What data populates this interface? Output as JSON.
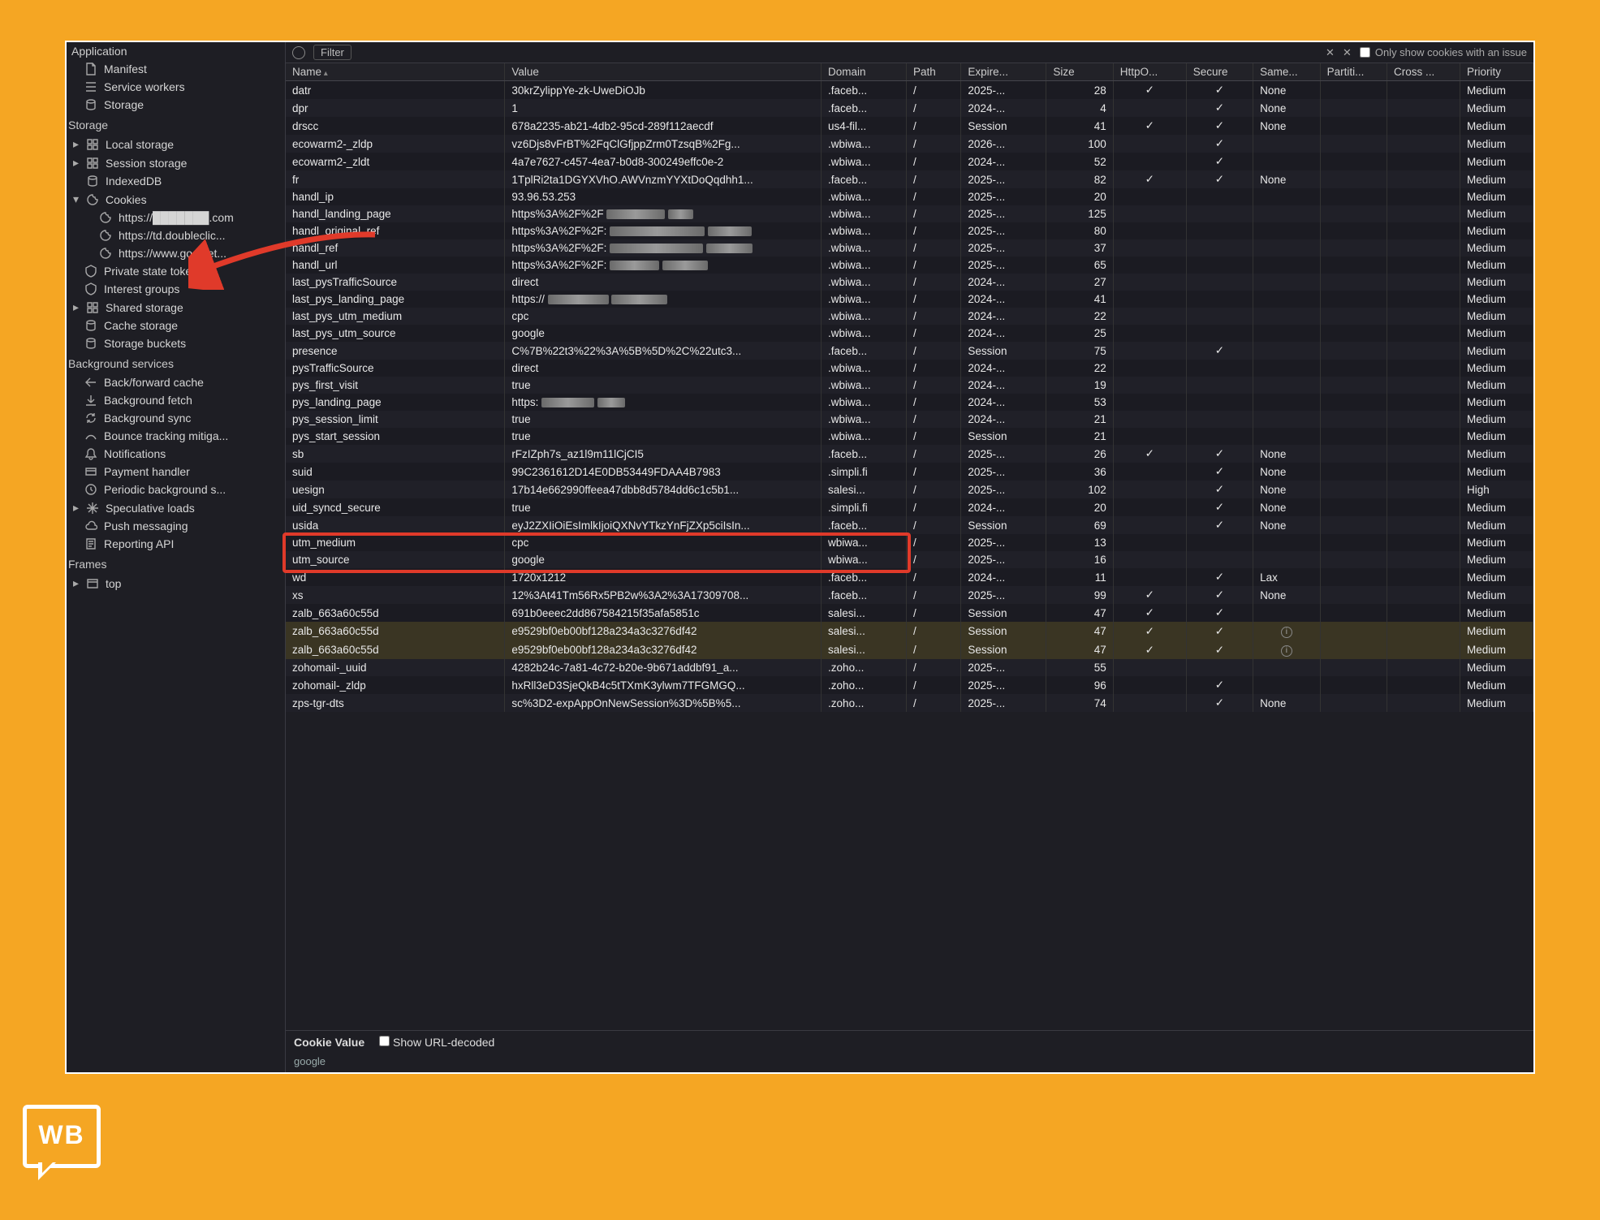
{
  "sidebar": {
    "header": "Application",
    "top_items": [
      {
        "icon": "file",
        "label": "Manifest"
      },
      {
        "icon": "gear-stack",
        "label": "Service workers"
      },
      {
        "icon": "db",
        "label": "Storage"
      }
    ],
    "storage_title": "Storage",
    "storage_items": [
      {
        "tri": "▸",
        "icon": "grid",
        "label": "Local storage"
      },
      {
        "tri": "▸",
        "icon": "grid",
        "label": "Session storage"
      },
      {
        "tri": "",
        "icon": "db",
        "label": "IndexedDB"
      },
      {
        "tri": "▾",
        "icon": "cookie",
        "label": "Cookies"
      }
    ],
    "cookie_children": [
      {
        "icon": "cookie",
        "label": "https://███████.com"
      },
      {
        "icon": "cookie",
        "label": "https://td.doubleclic..."
      },
      {
        "icon": "cookie",
        "label": "https://www.googlet..."
      }
    ],
    "storage_items2": [
      {
        "icon": "token",
        "label": "Private state tokens"
      },
      {
        "icon": "token",
        "label": "Interest groups"
      },
      {
        "tri": "▸",
        "icon": "grid",
        "label": "Shared storage"
      },
      {
        "icon": "db",
        "label": "Cache storage"
      },
      {
        "icon": "db",
        "label": "Storage buckets"
      }
    ],
    "bg_title": "Background services",
    "bg_items": [
      {
        "icon": "back",
        "label": "Back/forward cache"
      },
      {
        "icon": "down",
        "label": "Background fetch"
      },
      {
        "icon": "sync",
        "label": "Background sync"
      },
      {
        "icon": "bounce",
        "label": "Bounce tracking mitiga..."
      },
      {
        "icon": "bell",
        "label": "Notifications"
      },
      {
        "icon": "card",
        "label": "Payment handler"
      },
      {
        "icon": "clock",
        "label": "Periodic background s..."
      },
      {
        "tri": "▸",
        "icon": "spark",
        "label": "Speculative loads"
      },
      {
        "icon": "cloud",
        "label": "Push messaging"
      },
      {
        "icon": "report",
        "label": "Reporting API"
      }
    ],
    "frames_title": "Frames",
    "frames_items": [
      {
        "tri": "▸",
        "icon": "window",
        "label": "top"
      }
    ]
  },
  "toolbar": {
    "filter_label": "Filter",
    "only_issue_label": "Only show cookies with an issue"
  },
  "columns": [
    "Name",
    "Value",
    "Domain",
    "Path",
    "Expire...",
    "Size",
    "HttpO...",
    "Secure",
    "Same...",
    "Partiti...",
    "Cross ...",
    "Priority"
  ],
  "rows": [
    {
      "name": "datr",
      "value": "30krZylippYe-zk-UweDiOJb",
      "domain": ".faceb...",
      "path": "/",
      "exp": "2025-...",
      "size": "28",
      "http": "✓",
      "secure": "✓",
      "same": "None",
      "part": "",
      "cross": "",
      "prio": "Medium"
    },
    {
      "name": "dpr",
      "value": "1",
      "domain": ".faceb...",
      "path": "/",
      "exp": "2024-...",
      "size": "4",
      "http": "",
      "secure": "✓",
      "same": "None",
      "part": "",
      "cross": "",
      "prio": "Medium"
    },
    {
      "name": "drscc",
      "value": "678a2235-ab21-4db2-95cd-289f112aecdf",
      "domain": "us4-fil...",
      "path": "/",
      "exp": "Session",
      "size": "41",
      "http": "✓",
      "secure": "✓",
      "same": "None",
      "part": "",
      "cross": "",
      "prio": "Medium"
    },
    {
      "name": "ecowarm2-_zldp",
      "value": "vz6Djs8vFrBT%2FqClGfjppZrm0TzsqB%2Fg...",
      "domain": ".wbiwa...",
      "path": "/",
      "exp": "2026-...",
      "size": "100",
      "http": "",
      "secure": "✓",
      "same": "",
      "part": "",
      "cross": "",
      "prio": "Medium"
    },
    {
      "name": "ecowarm2-_zldt",
      "value": "4a7e7627-c457-4ea7-b0d8-300249effc0e-2",
      "domain": ".wbiwa...",
      "path": "/",
      "exp": "2024-...",
      "size": "52",
      "http": "",
      "secure": "✓",
      "same": "",
      "part": "",
      "cross": "",
      "prio": "Medium"
    },
    {
      "name": "fr",
      "value": "1TplRi2ta1DGYXVhO.AWVnzmYYXtDoQqdhh1...",
      "domain": ".faceb...",
      "path": "/",
      "exp": "2025-...",
      "size": "82",
      "http": "✓",
      "secure": "✓",
      "same": "None",
      "part": "",
      "cross": "",
      "prio": "Medium"
    },
    {
      "name": "handl_ip",
      "value": "93.96.53.253",
      "domain": ".wbiwa...",
      "path": "/",
      "exp": "2025-...",
      "size": "20",
      "http": "",
      "secure": "",
      "same": "",
      "part": "",
      "cross": "",
      "prio": "Medium"
    },
    {
      "name": "handl_landing_page",
      "value": "https%3A%2F%2F",
      "value_redacted": true,
      "domain": ".wbiwa...",
      "path": "/",
      "exp": "2025-...",
      "size": "125",
      "http": "",
      "secure": "",
      "same": "",
      "part": "",
      "cross": "",
      "prio": "Medium"
    },
    {
      "name": "handl_original_ref",
      "value": "https%3A%2F%2F:",
      "value_redacted": true,
      "domain": ".wbiwa...",
      "path": "/",
      "exp": "2025-...",
      "size": "80",
      "http": "",
      "secure": "",
      "same": "",
      "part": "",
      "cross": "",
      "prio": "Medium"
    },
    {
      "name": "handl_ref",
      "value": "https%3A%2F%2F:",
      "value_redacted": true,
      "domain": ".wbiwa...",
      "path": "/",
      "exp": "2025-...",
      "size": "37",
      "http": "",
      "secure": "",
      "same": "",
      "part": "",
      "cross": "",
      "prio": "Medium"
    },
    {
      "name": "handl_url",
      "value": "https%3A%2F%2F:",
      "value_redacted": true,
      "domain": ".wbiwa...",
      "path": "/",
      "exp": "2025-...",
      "size": "65",
      "http": "",
      "secure": "",
      "same": "",
      "part": "",
      "cross": "",
      "prio": "Medium"
    },
    {
      "name": "last_pysTrafficSource",
      "value": "direct",
      "domain": ".wbiwa...",
      "path": "/",
      "exp": "2024-...",
      "size": "27",
      "http": "",
      "secure": "",
      "same": "",
      "part": "",
      "cross": "",
      "prio": "Medium"
    },
    {
      "name": "last_pys_landing_page",
      "value": "https://",
      "value_redacted": true,
      "domain": ".wbiwa...",
      "path": "/",
      "exp": "2024-...",
      "size": "41",
      "http": "",
      "secure": "",
      "same": "",
      "part": "",
      "cross": "",
      "prio": "Medium"
    },
    {
      "name": "last_pys_utm_medium",
      "value": "cpc",
      "domain": ".wbiwa...",
      "path": "/",
      "exp": "2024-...",
      "size": "22",
      "http": "",
      "secure": "",
      "same": "",
      "part": "",
      "cross": "",
      "prio": "Medium"
    },
    {
      "name": "last_pys_utm_source",
      "value": "google",
      "domain": ".wbiwa...",
      "path": "/",
      "exp": "2024-...",
      "size": "25",
      "http": "",
      "secure": "",
      "same": "",
      "part": "",
      "cross": "",
      "prio": "Medium"
    },
    {
      "name": "presence",
      "value": "C%7B%22t3%22%3A%5B%5D%2C%22utc3...",
      "domain": ".faceb...",
      "path": "/",
      "exp": "Session",
      "size": "75",
      "http": "",
      "secure": "✓",
      "same": "",
      "part": "",
      "cross": "",
      "prio": "Medium"
    },
    {
      "name": "pysTrafficSource",
      "value": "direct",
      "domain": ".wbiwa...",
      "path": "/",
      "exp": "2024-...",
      "size": "22",
      "http": "",
      "secure": "",
      "same": "",
      "part": "",
      "cross": "",
      "prio": "Medium"
    },
    {
      "name": "pys_first_visit",
      "value": "true",
      "domain": ".wbiwa...",
      "path": "/",
      "exp": "2024-...",
      "size": "19",
      "http": "",
      "secure": "",
      "same": "",
      "part": "",
      "cross": "",
      "prio": "Medium"
    },
    {
      "name": "pys_landing_page",
      "value": "https:",
      "value_redacted": true,
      "domain": ".wbiwa...",
      "path": "/",
      "exp": "2024-...",
      "size": "53",
      "http": "",
      "secure": "",
      "same": "",
      "part": "",
      "cross": "",
      "prio": "Medium"
    },
    {
      "name": "pys_session_limit",
      "value": "true",
      "domain": ".wbiwa...",
      "path": "/",
      "exp": "2024-...",
      "size": "21",
      "http": "",
      "secure": "",
      "same": "",
      "part": "",
      "cross": "",
      "prio": "Medium"
    },
    {
      "name": "pys_start_session",
      "value": "true",
      "domain": ".wbiwa...",
      "path": "/",
      "exp": "Session",
      "size": "21",
      "http": "",
      "secure": "",
      "same": "",
      "part": "",
      "cross": "",
      "prio": "Medium"
    },
    {
      "name": "sb",
      "value": "rFzIZph7s_az1l9m11lCjCI5",
      "domain": ".faceb...",
      "path": "/",
      "exp": "2025-...",
      "size": "26",
      "http": "✓",
      "secure": "✓",
      "same": "None",
      "part": "",
      "cross": "",
      "prio": "Medium"
    },
    {
      "name": "suid",
      "value": "99C2361612D14E0DB53449FDAA4B7983",
      "domain": ".simpli.fi",
      "path": "/",
      "exp": "2025-...",
      "size": "36",
      "http": "",
      "secure": "✓",
      "same": "None",
      "part": "",
      "cross": "",
      "prio": "Medium"
    },
    {
      "name": "uesign",
      "value": "17b14e662990ffeea47dbb8d5784dd6c1c5b1...",
      "domain": "salesi...",
      "path": "/",
      "exp": "2025-...",
      "size": "102",
      "http": "",
      "secure": "✓",
      "same": "None",
      "part": "",
      "cross": "",
      "prio": "High"
    },
    {
      "name": "uid_syncd_secure",
      "value": "true",
      "domain": ".simpli.fi",
      "path": "/",
      "exp": "2024-...",
      "size": "20",
      "http": "",
      "secure": "✓",
      "same": "None",
      "part": "",
      "cross": "",
      "prio": "Medium"
    },
    {
      "name": "usida",
      "value": "eyJ2ZXIiOiEsImlkIjoiQXNvYTkzYnFjZXp5ciIsIn...",
      "domain": ".faceb...",
      "path": "/",
      "exp": "Session",
      "size": "69",
      "http": "",
      "secure": "✓",
      "same": "None",
      "part": "",
      "cross": "",
      "prio": "Medium"
    },
    {
      "name": "utm_medium",
      "value": "cpc",
      "domain": "wbiwa...",
      "path": "/",
      "exp": "2025-...",
      "size": "13",
      "http": "",
      "secure": "",
      "same": "",
      "part": "",
      "cross": "",
      "prio": "Medium",
      "hl": true
    },
    {
      "name": "utm_source",
      "value": "google",
      "domain": "wbiwa...",
      "path": "/",
      "exp": "2025-...",
      "size": "16",
      "http": "",
      "secure": "",
      "same": "",
      "part": "",
      "cross": "",
      "prio": "Medium",
      "hl": true
    },
    {
      "name": "wd",
      "value": "1720x1212",
      "domain": ".faceb...",
      "path": "/",
      "exp": "2024-...",
      "size": "11",
      "http": "",
      "secure": "✓",
      "same": "Lax",
      "part": "",
      "cross": "",
      "prio": "Medium"
    },
    {
      "name": "xs",
      "value": "12%3At41Tm56Rx5PB2w%3A2%3A17309708...",
      "domain": ".faceb...",
      "path": "/",
      "exp": "2025-...",
      "size": "99",
      "http": "✓",
      "secure": "✓",
      "same": "None",
      "part": "",
      "cross": "",
      "prio": "Medium"
    },
    {
      "name": "zalb_663a60c55d",
      "value": "691b0eeec2dd867584215f35afa5851c",
      "domain": "salesi...",
      "path": "/",
      "exp": "Session",
      "size": "47",
      "http": "✓",
      "secure": "✓",
      "same": "",
      "part": "",
      "cross": "",
      "prio": "Medium"
    },
    {
      "name": "zalb_663a60c55d",
      "value": "e9529bf0eb00bf128a234a3c3276df42",
      "domain": "salesi...",
      "path": "/",
      "exp": "Session",
      "size": "47",
      "http": "✓",
      "secure": "✓",
      "same": "ⓘ",
      "part": "",
      "cross": "",
      "prio": "Medium",
      "yellow": true
    },
    {
      "name": "zalb_663a60c55d",
      "value": "e9529bf0eb00bf128a234a3c3276df42",
      "domain": "salesi...",
      "path": "/",
      "exp": "Session",
      "size": "47",
      "http": "✓",
      "secure": "✓",
      "same": "ⓘ",
      "part": "",
      "cross": "",
      "prio": "Medium",
      "yellow": true
    },
    {
      "name": "zohomail-_uuid",
      "value": "4282b24c-7a81-4c72-b20e-9b671addbf91_a...",
      "domain": ".zoho...",
      "path": "/",
      "exp": "2025-...",
      "size": "55",
      "http": "",
      "secure": "",
      "same": "",
      "part": "",
      "cross": "",
      "prio": "Medium"
    },
    {
      "name": "zohomail-_zldp",
      "value": "hxRll3eD3SjeQkB4c5tTXmK3ylwm7TFGMGQ...",
      "domain": ".zoho...",
      "path": "/",
      "exp": "2025-...",
      "size": "96",
      "http": "",
      "secure": "✓",
      "same": "",
      "part": "",
      "cross": "",
      "prio": "Medium"
    },
    {
      "name": "zps-tgr-dts",
      "value": "sc%3D2-expAppOnNewSession%3D%5B%5...",
      "domain": ".zoho...",
      "path": "/",
      "exp": "2025-...",
      "size": "74",
      "http": "",
      "secure": "✓",
      "same": "None",
      "part": "",
      "cross": "",
      "prio": "Medium"
    }
  ],
  "footer": {
    "label": "Cookie Value",
    "checkbox": "Show URL-decoded",
    "preview": "google"
  }
}
